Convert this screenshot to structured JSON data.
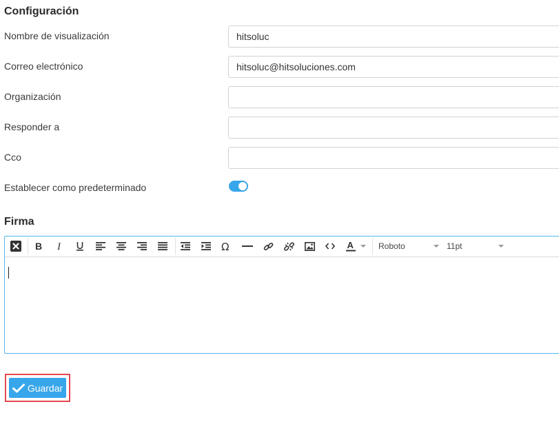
{
  "section_config": {
    "title": "Configuración"
  },
  "fields": {
    "display_name": {
      "label": "Nombre de visualización",
      "value": "hitsoluc"
    },
    "email": {
      "label": "Correo electrónico",
      "value": "hitsoluc@hitsoluciones.com"
    },
    "organization": {
      "label": "Organización",
      "value": ""
    },
    "reply_to": {
      "label": "Responder a",
      "value": ""
    },
    "bcc": {
      "label": "Cco",
      "value": ""
    },
    "set_default": {
      "label": "Establecer como predeterminado",
      "checked": true
    }
  },
  "signature": {
    "title": "Firma",
    "toolbar": {
      "font_family": "Roboto",
      "font_size": "11pt",
      "buttons": [
        "clear-html-icon",
        "bold-icon",
        "italic-icon",
        "underline-icon",
        "align-left-icon",
        "align-center-icon",
        "align-right-icon",
        "align-justify-icon",
        "outdent-icon",
        "indent-icon",
        "special-character-icon",
        "horizontal-rule-icon",
        "link-icon",
        "unlink-icon",
        "image-icon",
        "source-code-icon",
        "text-color-icon"
      ]
    },
    "content": ""
  },
  "actions": {
    "save_label": "Guardar"
  },
  "colors": {
    "accent": "#37a6ea",
    "highlight_frame": "#e5474f",
    "editor_border": "#51b5ee"
  }
}
